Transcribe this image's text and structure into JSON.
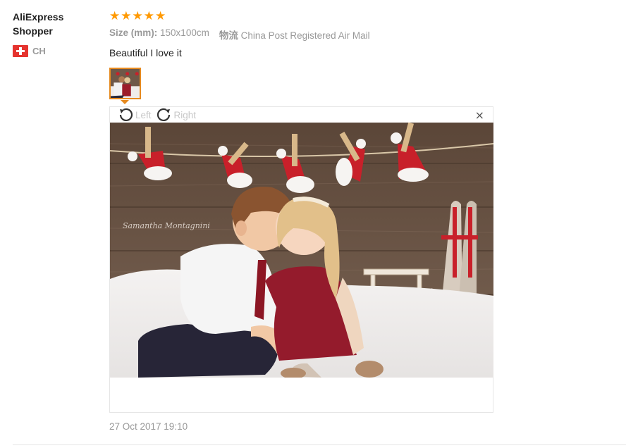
{
  "buyer": {
    "name": "AliExpress Shopper",
    "country_code": "CH",
    "flag_icon": "switzerland-flag-icon"
  },
  "review": {
    "rating": 5,
    "rating_max": 5,
    "star_color": "#ff9900",
    "size_label": "Size (mm):",
    "size_value": "150x100cm",
    "shipping_label": "物流",
    "shipping_value": "China Post Registered Air Mail",
    "text": "Beautiful I love it",
    "timestamp": "27 Oct 2017 19:10"
  },
  "image_viewer": {
    "rotate_left_label": "Left",
    "rotate_right_label": "Right",
    "close_glyph": "×",
    "photo_watermark": "Samantha Montagnini",
    "active_thumb_border_color": "#e68a1f"
  }
}
